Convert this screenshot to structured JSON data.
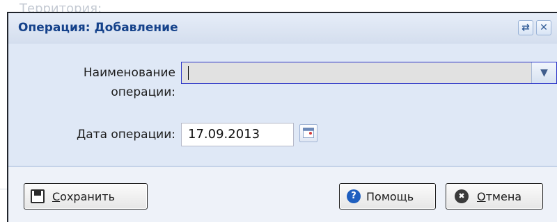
{
  "background": {
    "territory_label": "Территория:"
  },
  "dialog": {
    "title": "Операция: Добавление",
    "tools": [
      {
        "name": "refresh",
        "icon": "refresh-icon",
        "glyph": "⇄"
      },
      {
        "name": "close",
        "icon": "close-icon",
        "glyph": "✕"
      }
    ],
    "fields": {
      "operation_name": {
        "label_line1": "Наименование",
        "label_line2": "операции:",
        "value": ""
      },
      "operation_date": {
        "label": "Дата операции:",
        "value": "17.09.2013"
      }
    },
    "buttons": {
      "save": {
        "hotkey": "С",
        "rest": "охранить",
        "icon": "save-icon"
      },
      "help": {
        "label": "Помощь",
        "icon": "help-icon",
        "glyph": "?"
      },
      "cancel": {
        "hotkey": "О",
        "rest": "тмена",
        "icon": "cancel-icon",
        "glyph": "✖"
      }
    }
  },
  "colors": {
    "title_text": "#15428b",
    "panel_bg": "#dfe8f6",
    "combo_border": "#2832c8",
    "help_icon": "#1f5fbf",
    "cancel_icon": "#3a3a3a"
  }
}
